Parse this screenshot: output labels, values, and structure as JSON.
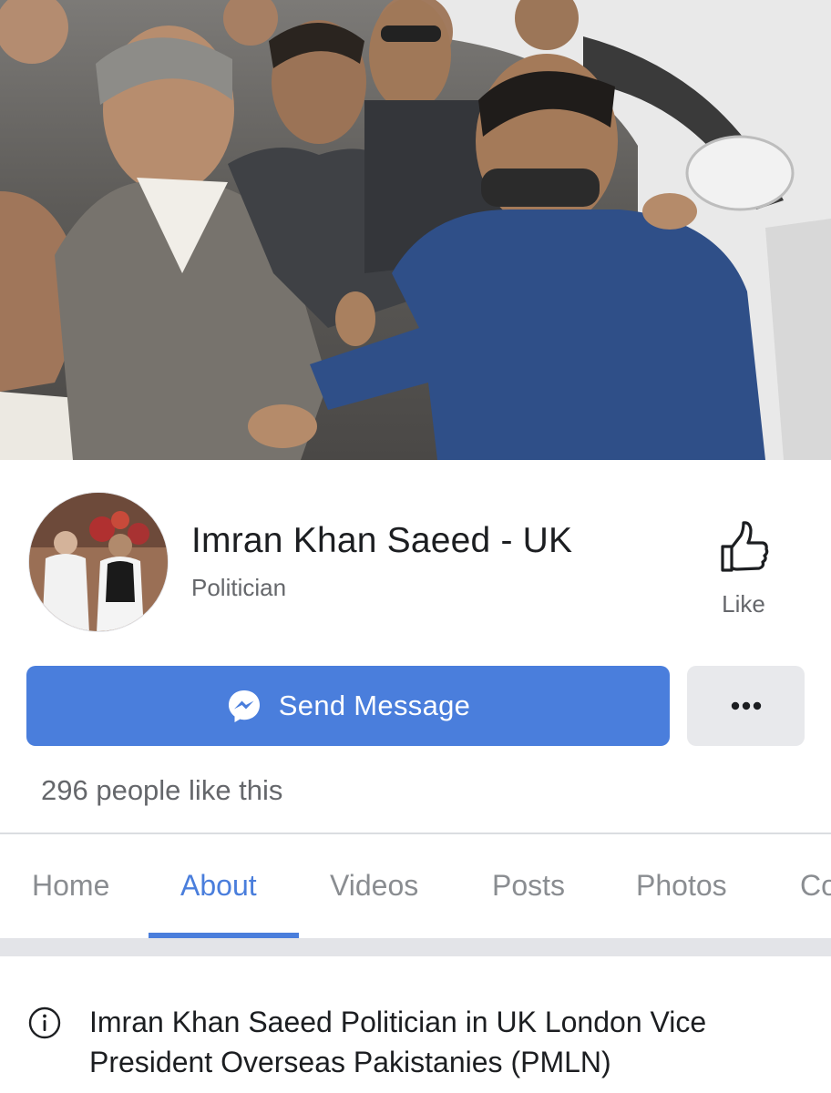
{
  "page": {
    "name": "Imran Khan Saeed - UK",
    "category": "Politician"
  },
  "actions": {
    "like_label": "Like",
    "send_message_label": "Send Message"
  },
  "likes_summary": "296 people like this",
  "tabs": [
    {
      "label": "Home",
      "active": false
    },
    {
      "label": "About",
      "active": true
    },
    {
      "label": "Videos",
      "active": false
    },
    {
      "label": "Posts",
      "active": false
    },
    {
      "label": "Photos",
      "active": false
    },
    {
      "label": "Co",
      "active": false
    }
  ],
  "about": {
    "text": "Imran Khan Saeed Politician in UK London Vice President Overseas Pakistanies (PMLN)"
  },
  "icons": {
    "like": "thumbs-up-icon",
    "send": "messenger-icon",
    "more": "more-dots-icon",
    "info": "info-icon"
  },
  "colors": {
    "accent": "#4a7edc",
    "muted_text": "#65676b",
    "tab_inactive": "#8a8d91",
    "button_secondary": "#e8e9ec"
  }
}
